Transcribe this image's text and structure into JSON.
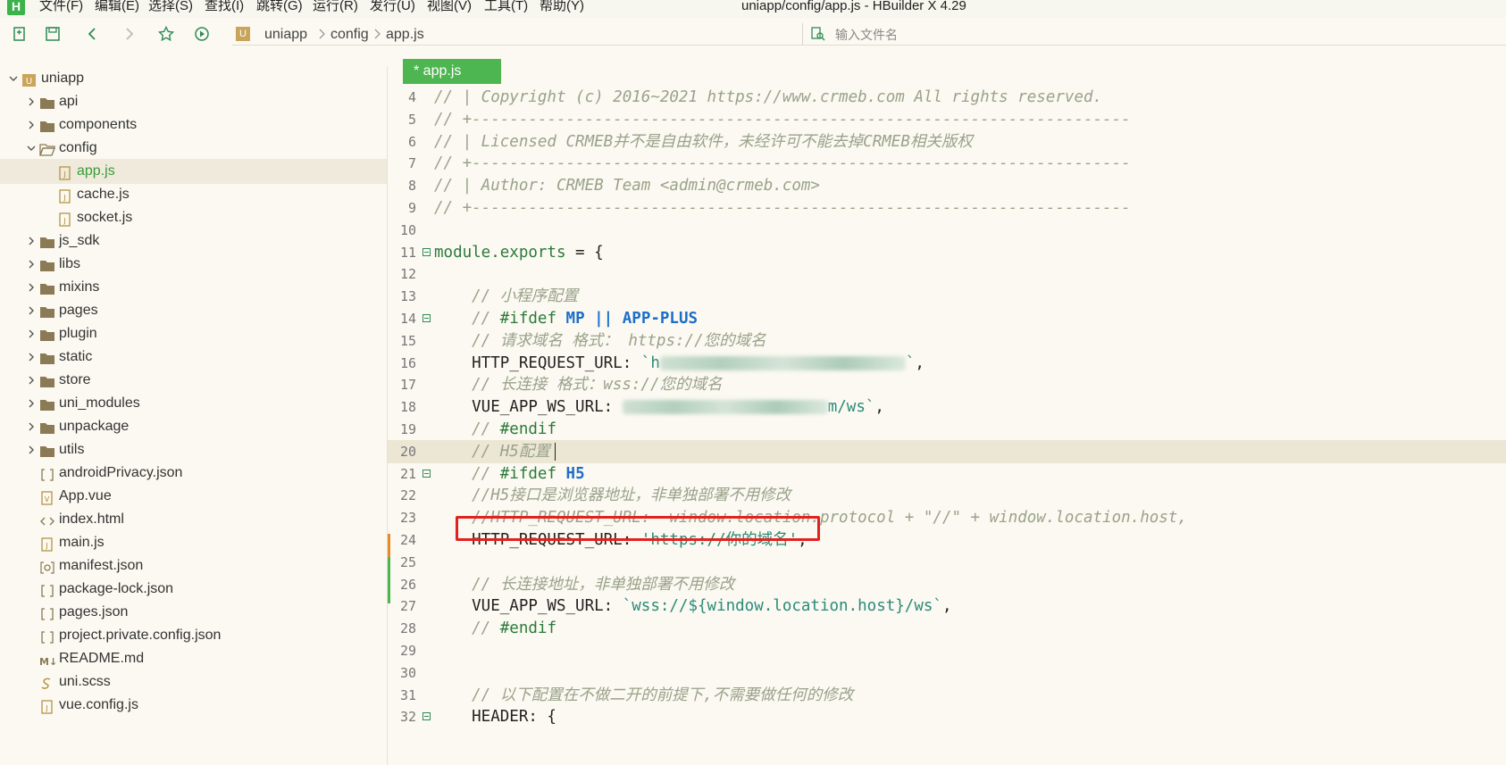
{
  "app": {
    "logo_letter": "H",
    "window_title": "uniapp/config/app.js - HBuilder X 4.29"
  },
  "menu": [
    {
      "label": "文件(F)"
    },
    {
      "label": "编辑(E)"
    },
    {
      "label": "选择(S)"
    },
    {
      "label": "查找(I)"
    },
    {
      "label": "跳转(G)"
    },
    {
      "label": "运行(R)"
    },
    {
      "label": "发行(U)"
    },
    {
      "label": "视图(V)"
    },
    {
      "label": "工具(T)"
    },
    {
      "label": "帮助(Y)"
    }
  ],
  "toolbar": {
    "icons": [
      "new-file-icon",
      "save-icon",
      "back-icon",
      "forward-icon",
      "favorite-icon",
      "run-icon"
    ],
    "breadcrumb": [
      "uniapp",
      "config",
      "app.js"
    ],
    "file_search_placeholder": "输入文件名"
  },
  "sidebar": {
    "items": [
      {
        "label": "uniapp",
        "type": "project",
        "expanded": true
      },
      {
        "label": "api",
        "type": "folder"
      },
      {
        "label": "components",
        "type": "folder"
      },
      {
        "label": "config",
        "type": "folder",
        "expanded": true
      },
      {
        "label": "app.js",
        "type": "js",
        "selected": true
      },
      {
        "label": "cache.js",
        "type": "js"
      },
      {
        "label": "socket.js",
        "type": "js"
      },
      {
        "label": "js_sdk",
        "type": "folder"
      },
      {
        "label": "libs",
        "type": "folder"
      },
      {
        "label": "mixins",
        "type": "folder"
      },
      {
        "label": "pages",
        "type": "folder"
      },
      {
        "label": "plugin",
        "type": "folder"
      },
      {
        "label": "static",
        "type": "folder"
      },
      {
        "label": "store",
        "type": "folder"
      },
      {
        "label": "uni_modules",
        "type": "folder"
      },
      {
        "label": "unpackage",
        "type": "folder"
      },
      {
        "label": "utils",
        "type": "folder"
      },
      {
        "label": "androidPrivacy.json",
        "type": "json"
      },
      {
        "label": "App.vue",
        "type": "vue"
      },
      {
        "label": "index.html",
        "type": "html"
      },
      {
        "label": "main.js",
        "type": "js"
      },
      {
        "label": "manifest.json",
        "type": "manifest"
      },
      {
        "label": "package-lock.json",
        "type": "json"
      },
      {
        "label": "pages.json",
        "type": "json"
      },
      {
        "label": "project.private.config.json",
        "type": "json"
      },
      {
        "label": "README.md",
        "type": "md"
      },
      {
        "label": "uni.scss",
        "type": "scss"
      },
      {
        "label": "vue.config.js",
        "type": "js"
      }
    ]
  },
  "editor": {
    "tab_label": "* app.js",
    "current_line": 20,
    "highlighted_line": 24,
    "lines": [
      {
        "n": "4",
        "tokens": [
          {
            "c": "cmt",
            "t": "// | Copyright (c) 2016~2021 https://www.crmeb.com All rights reserved."
          }
        ]
      },
      {
        "n": "5",
        "tokens": [
          {
            "c": "cmt",
            "t": "// +----------------------------------------------------------------------"
          }
        ]
      },
      {
        "n": "6",
        "tokens": [
          {
            "c": "cmt",
            "t": "// | Licensed CRMEB并不是自由软件，未经许可不能去掉CRMEB相关版权"
          }
        ]
      },
      {
        "n": "7",
        "tokens": [
          {
            "c": "cmt",
            "t": "// +----------------------------------------------------------------------"
          }
        ]
      },
      {
        "n": "8",
        "tokens": [
          {
            "c": "cmt",
            "t": "// | Author: CRMEB Team <admin@crmeb.com>"
          }
        ]
      },
      {
        "n": "9",
        "tokens": [
          {
            "c": "cmt",
            "t": "// +----------------------------------------------------------------------"
          }
        ]
      },
      {
        "n": "10",
        "tokens": []
      },
      {
        "n": "11",
        "fold": true,
        "tokens": [
          {
            "c": "kw",
            "t": "module.exports"
          },
          {
            "c": "pl",
            "t": " = {"
          }
        ]
      },
      {
        "n": "12",
        "tokens": []
      },
      {
        "n": "13",
        "tokens": [
          {
            "c": "cmt",
            "t": "    // 小程序配置"
          }
        ]
      },
      {
        "n": "14",
        "fold": true,
        "tokens": [
          {
            "c": "cmt",
            "t": "    // "
          },
          {
            "c": "pp",
            "t": "#ifdef "
          },
          {
            "c": "mac",
            "t": "MP || APP-PLUS"
          }
        ]
      },
      {
        "n": "15",
        "tokens": [
          {
            "c": "cmt",
            "t": "    // 请求域名 格式： https://您的域名"
          }
        ]
      },
      {
        "n": "16",
        "tokens": [
          {
            "c": "pl",
            "t": "    HTTP_REQUEST_URL: "
          },
          {
            "c": "str",
            "t": "`h"
          },
          {
            "c": "blur",
            "w": 275
          },
          {
            "c": "str",
            "t": "`"
          },
          {
            "c": "pl",
            "t": ","
          }
        ]
      },
      {
        "n": "17",
        "tokens": [
          {
            "c": "cmt",
            "t": "    // 长连接 格式：wss://您的域名"
          }
        ]
      },
      {
        "n": "18",
        "tokens": [
          {
            "c": "pl",
            "t": "    VUE_APP_WS_URL: "
          },
          {
            "c": "blur",
            "w": 230
          },
          {
            "c": "str",
            "t": "m/ws`"
          },
          {
            "c": "pl",
            "t": ","
          }
        ]
      },
      {
        "n": "19",
        "tokens": [
          {
            "c": "cmt",
            "t": "    // "
          },
          {
            "c": "pp",
            "t": "#endif"
          }
        ]
      },
      {
        "n": "20",
        "tokens": [
          {
            "c": "cmt",
            "t": "    // H5配置"
          }
        ]
      },
      {
        "n": "21",
        "fold": true,
        "tokens": [
          {
            "c": "cmt",
            "t": "    // "
          },
          {
            "c": "pp",
            "t": "#ifdef "
          },
          {
            "c": "mac",
            "t": "H5"
          }
        ]
      },
      {
        "n": "22",
        "tokens": [
          {
            "c": "cmt",
            "t": "    //H5接口是浏览器地址，非单独部署不用修改"
          }
        ]
      },
      {
        "n": "23",
        "tokens": [
          {
            "c": "cmt",
            "t": "    //HTTP_REQUEST_URL:  window.location.protocol + \"//\" + window.location.host,"
          }
        ]
      },
      {
        "n": "24",
        "tokens": [
          {
            "c": "pl",
            "t": "    HTTP_REQUEST_URL: "
          },
          {
            "c": "str",
            "t": "'https://你的域名'"
          },
          {
            "c": "pl",
            "t": ","
          }
        ]
      },
      {
        "n": "25",
        "tokens": []
      },
      {
        "n": "26",
        "tokens": [
          {
            "c": "cmt",
            "t": "    // 长连接地址，非单独部署不用修改"
          }
        ]
      },
      {
        "n": "27",
        "tokens": [
          {
            "c": "pl",
            "t": "    VUE_APP_WS_URL: "
          },
          {
            "c": "str",
            "t": "`wss://${window.location.host}/ws`"
          },
          {
            "c": "pl",
            "t": ","
          }
        ]
      },
      {
        "n": "28",
        "tokens": [
          {
            "c": "cmt",
            "t": "    // "
          },
          {
            "c": "pp",
            "t": "#endif"
          }
        ]
      },
      {
        "n": "29",
        "tokens": []
      },
      {
        "n": "30",
        "tokens": []
      },
      {
        "n": "31",
        "tokens": [
          {
            "c": "cmt",
            "t": "    // 以下配置在不做二开的前提下,不需要做任何的修改"
          }
        ]
      },
      {
        "n": "32",
        "fold": true,
        "tokens": [
          {
            "c": "pl",
            "t": "    HEADER: {"
          }
        ]
      }
    ]
  },
  "colors": {
    "accent_green": "#4eb651",
    "highlight_red": "#e1231f",
    "editor_bg": "#fbf9f1",
    "current_line_bg": "#ece6d4"
  }
}
